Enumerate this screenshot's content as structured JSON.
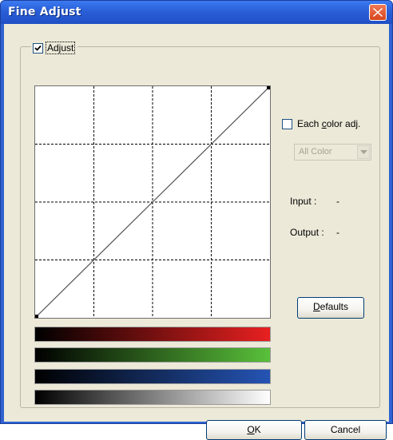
{
  "window": {
    "title": "Fine Adjust",
    "close_icon": "close-x-icon"
  },
  "adjust_group": {
    "label": "Adjust",
    "checked": true
  },
  "each_color": {
    "label_prefix": "Each ",
    "label_mnemonic": "c",
    "label_suffix": "olor adj.",
    "checked": false
  },
  "color_select": {
    "value": "All Color",
    "arrow_icon": "dropdown-arrow-icon"
  },
  "readout": {
    "input_label": "Input :",
    "input_value": "-",
    "output_label": "Output :",
    "output_value": "-"
  },
  "buttons": {
    "defaults_mnemonic": "D",
    "defaults_rest": "efaults",
    "ok_mnemonic": "O",
    "ok_rest": "K",
    "cancel": "Cancel"
  },
  "colors": {
    "titlebar": "#2a5fd8",
    "dialog_bg": "#ece9d8",
    "red_end": "#e82020",
    "green_end": "#59c03a",
    "blue_end": "#2554b4",
    "gray_end": "#ffffff"
  },
  "tone_curve": {
    "grid_divisions": 4,
    "points": [
      [
        0,
        0
      ],
      [
        255,
        255
      ]
    ]
  }
}
